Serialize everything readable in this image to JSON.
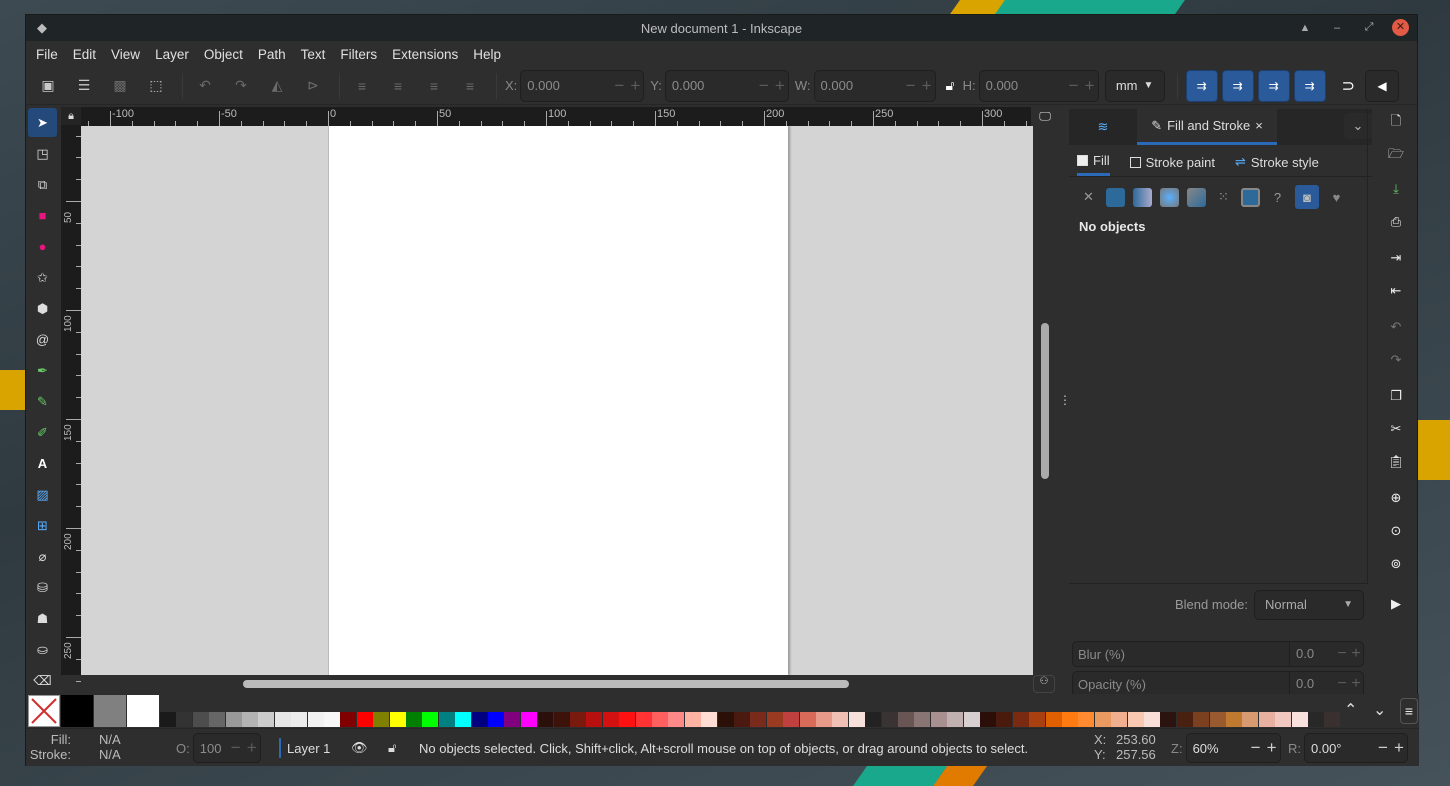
{
  "window": {
    "title": "New document 1 - Inkscape",
    "controls": [
      "keep-above",
      "minimize",
      "maximize",
      "close"
    ]
  },
  "menubar": [
    "File",
    "Edit",
    "View",
    "Layer",
    "Object",
    "Path",
    "Text",
    "Filters",
    "Extensions",
    "Help"
  ],
  "toolbar": {
    "x": {
      "label": "X:",
      "value": "0.000"
    },
    "y": {
      "label": "Y:",
      "value": "0.000"
    },
    "w": {
      "label": "W:",
      "value": "0.000"
    },
    "h": {
      "label": "H:",
      "value": "0.000"
    },
    "unit": "mm",
    "minus": "−",
    "plus": "+"
  },
  "ruler": {
    "h_labels": [
      "-100",
      "-50",
      "0",
      "50",
      "100",
      "150",
      "200",
      "250",
      "300"
    ],
    "v_labels": [
      "50",
      "100",
      "150",
      "200",
      "250"
    ]
  },
  "panel": {
    "tab_label": "Fill and Stroke",
    "tab_close": "×",
    "subtabs": [
      "Fill",
      "Stroke paint",
      "Stroke style"
    ],
    "no_objects": "No objects",
    "blend_label": "Blend mode:",
    "blend_value": "Normal",
    "blur_label": "Blur (%)",
    "blur_value": "0.0",
    "opacity_label": "Opacity (%)",
    "opacity_value": "0.0"
  },
  "palette": {
    "big": [
      "#000000",
      "#808080",
      "#ffffff"
    ],
    "swatches": [
      "#1a1a1a",
      "#333333",
      "#4d4d4d",
      "#666666",
      "#999999",
      "#b3b3b3",
      "#cccccc",
      "#e6e6e6",
      "#ececec",
      "#f2f2f2",
      "#f8f8f8",
      "#800000",
      "#ff0000",
      "#808000",
      "#ffff00",
      "#008000",
      "#00ff00",
      "#008080",
      "#00ffff",
      "#000080",
      "#0000ff",
      "#800080",
      "#ff00ff",
      "#2b0f0a",
      "#3d120a",
      "#7a1a0f",
      "#b80f0f",
      "#d41111",
      "#ff1111",
      "#ff3333",
      "#ff5f5f",
      "#ff8888",
      "#ffb3a3",
      "#ffddd5",
      "#2b1008",
      "#4a1a10",
      "#7a2a1a",
      "#9a3a20",
      "#c04040",
      "#d86a5a",
      "#e89a8a",
      "#f0c0b5",
      "#f8e0da",
      "#222222",
      "#3a3333",
      "#6a5555",
      "#8a7575",
      "#a89090",
      "#c0b0b0",
      "#d8d0d0",
      "#2b0e08",
      "#4a1a0c",
      "#7a2a10",
      "#a84010",
      "#e06000",
      "#ff7a10",
      "#ff8a30",
      "#e89a60",
      "#f0b090",
      "#f8c8b0",
      "#f8e0d8",
      "#2b1410",
      "#4a2010",
      "#7a4020",
      "#9a5a30",
      "#c07a30",
      "#d89a70",
      "#e8b0a0",
      "#f0c8c0",
      "#f8e0dc",
      "#282828",
      "#3a3030"
    ]
  },
  "statusbar": {
    "fill_label": "Fill:",
    "fill_value": "N/A",
    "stroke_label": "Stroke:",
    "stroke_value": "N/A",
    "opacity_label": "O:",
    "opacity_value": "100",
    "layer": "Layer 1",
    "message": "No objects selected. Click, Shift+click, Alt+scroll mouse on top of objects, or drag around objects to select.",
    "x_label": "X:",
    "x_value": "253.60",
    "y_label": "Y:",
    "y_value": "257.56",
    "zoom_label": "Z:",
    "zoom_value": "60%",
    "rotate_label": "R:",
    "rotate_value": "0.00°"
  }
}
